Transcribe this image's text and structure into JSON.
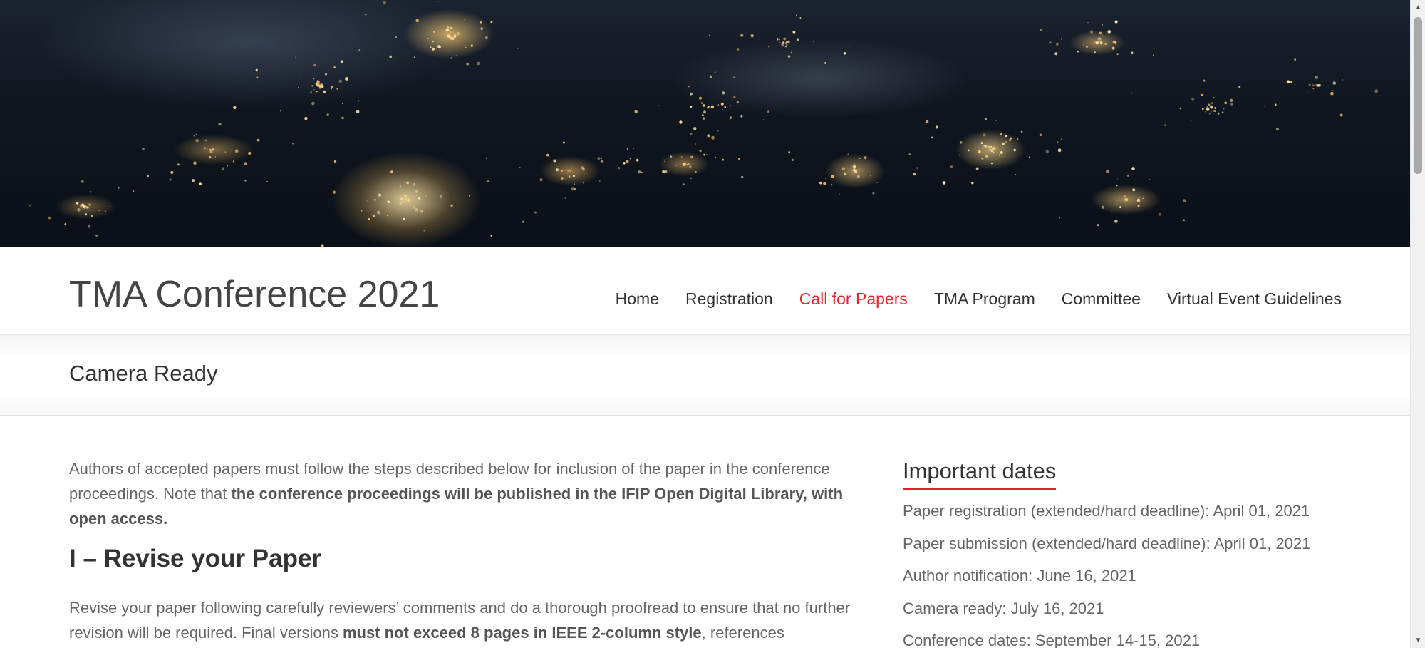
{
  "site": {
    "title": "TMA Conference 2021"
  },
  "nav": {
    "items": [
      {
        "label": "Home",
        "current": false
      },
      {
        "label": "Registration",
        "current": false
      },
      {
        "label": "Call for Papers",
        "current": true
      },
      {
        "label": "TMA Program",
        "current": false
      },
      {
        "label": "Committee",
        "current": false
      },
      {
        "label": "Virtual Event Guidelines",
        "current": false
      }
    ]
  },
  "page": {
    "title": "Camera Ready"
  },
  "content": {
    "intro": {
      "text": "Authors of accepted papers must follow the steps described below for inclusion of the paper in the conference proceedings. Note that ",
      "bold": "the conference proceedings will be published in the IFIP Open Digital Library, with open access."
    },
    "section1": {
      "heading": "I – Revise your Paper",
      "text_before": "Revise your paper following carefully reviewers’ comments and do a thorough proofread to ensure that no further revision will be required. Final versions ",
      "bold": "must not exceed 8 pages in IEEE 2-column style",
      "text_after": ", references"
    }
  },
  "sidebar": {
    "widget_title": "Important dates",
    "dates": [
      "Paper registration (extended/hard deadline): April 01, 2021",
      "Paper submission (extended/hard deadline): April 01, 2021",
      "Author notification: June 16, 2021",
      "Camera ready: July 16, 2021",
      "Conference dates: September 14-15, 2021"
    ]
  },
  "colors": {
    "accent": "#e4232c",
    "text": "#666666",
    "heading": "#333333"
  },
  "icons": {
    "scroll_up": "scroll-up-arrow-icon",
    "scroll_down": "scroll-down-arrow-icon"
  }
}
